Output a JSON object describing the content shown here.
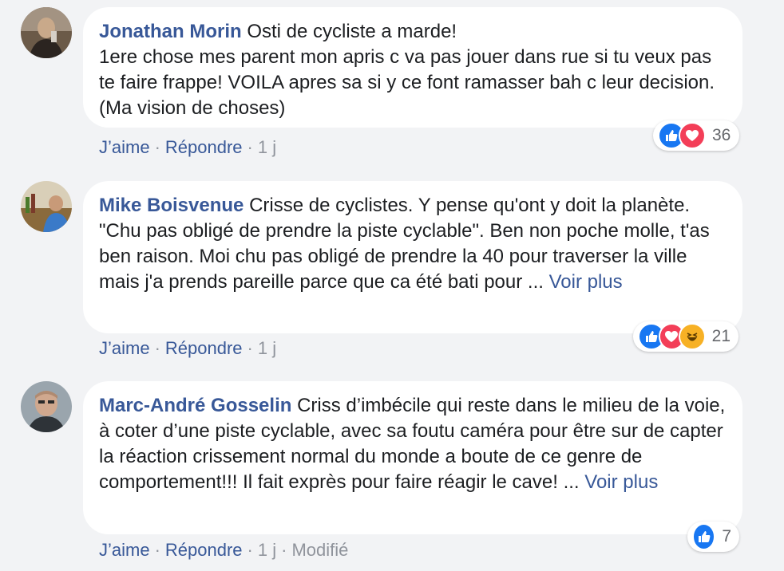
{
  "comments": [
    {
      "author": "Jonathan Morin",
      "text": "Osti de cycliste a marde!\n1ere chose mes parent mon apris c va pas jouer dans rue si tu veux pas te faire frappe! VOILA apres sa si y ce font ramasser bah c leur decision. (Ma vision de choses)",
      "reaction_count": "36",
      "reaction_icons": [
        "like-icon",
        "love-icon"
      ],
      "like_label": "J’aime",
      "reply_label": "Répondre",
      "time": "1 j"
    },
    {
      "author": "Mike Boisvenue",
      "text": "Crisse de cyclistes. Y pense qu'ont y doit la planète. \"Chu pas obligé de prendre la piste cyclable\". Ben non poche molle, t'as ben raison. Moi chu pas obligé de prendre la 40 pour traverser la ville mais j'a prends pareille parce que ca été bati pour ...",
      "see_more": "Voir plus",
      "reaction_count": "21",
      "reaction_icons": [
        "like-icon",
        "love-icon",
        "haha-icon"
      ],
      "like_label": "J’aime",
      "reply_label": "Répondre",
      "time": "1 j"
    },
    {
      "author": "Marc-André Gosselin",
      "text": "Criss d’imbécile qui reste dans le milieu de la voie, à coter d’une piste cyclable, avec sa foutu caméra pour être sur de capter la réaction crissement normal du monde a boute de ce genre de comportement!!! Il fait exprès pour faire réagir le cave! ...",
      "see_more": "Voir plus",
      "reaction_count": "7",
      "reaction_icons": [
        "like-icon"
      ],
      "like_label": "J’aime",
      "reply_label": "Répondre",
      "time": "1 j",
      "edited_label": "Modifié"
    }
  ],
  "colors": {
    "background": "#f2f3f5",
    "author": "#385898",
    "like": "#1877f2",
    "love": "#f33e58",
    "haha": "#f7b125"
  }
}
